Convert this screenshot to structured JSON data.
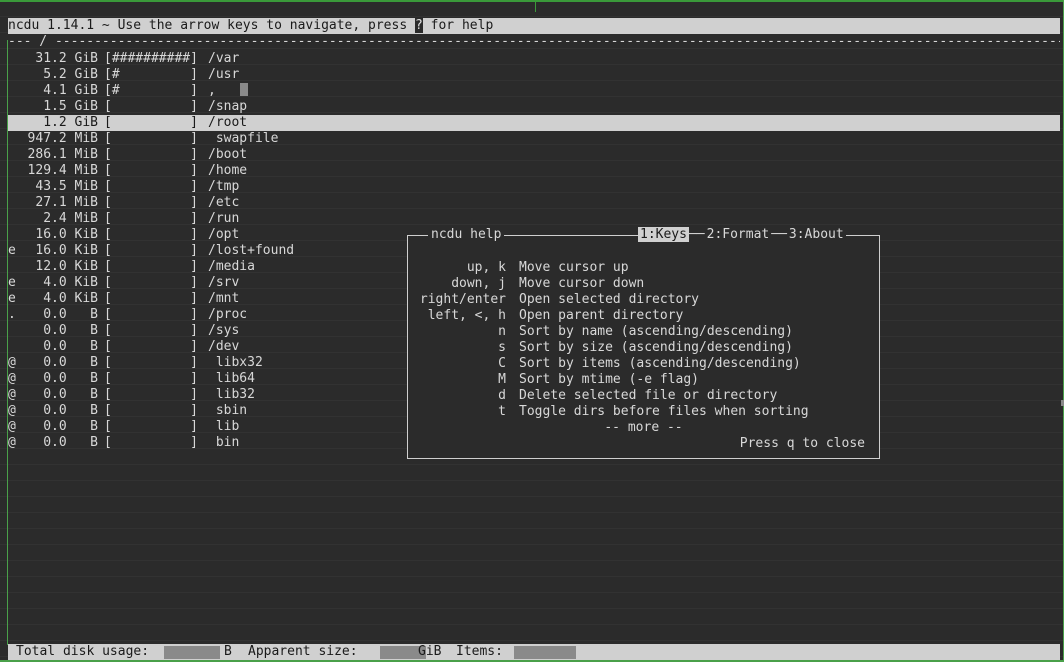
{
  "header": {
    "app": "ncdu 1.14.1",
    "tilde": "~",
    "text_before": " Use the arrow keys to navigate, press ",
    "help_key": "?",
    "text_after": " for help"
  },
  "path_line": "--- / ------------------------------------------------------------------------------------------------------------------------------------",
  "rows": [
    {
      "flag": "",
      "size": "31.2 GiB",
      "bar": "[##########]",
      "name": "/var"
    },
    {
      "flag": "",
      "size": "5.2 GiB",
      "bar": "[#         ]",
      "name": "/usr"
    },
    {
      "flag": "",
      "size": "4.1 GiB",
      "bar": "[#         ]",
      "name": ","
    },
    {
      "flag": "",
      "size": "1.5 GiB",
      "bar": "[          ]",
      "name": "/snap"
    },
    {
      "flag": "",
      "size": "1.2 GiB",
      "bar": "[          ]",
      "name": "/root",
      "selected": true
    },
    {
      "flag": "",
      "size": "947.2 MiB",
      "bar": "[          ]",
      "name": " swapfile"
    },
    {
      "flag": "",
      "size": "286.1 MiB",
      "bar": "[          ]",
      "name": "/boot"
    },
    {
      "flag": "",
      "size": "129.4 MiB",
      "bar": "[          ]",
      "name": "/home"
    },
    {
      "flag": "",
      "size": "43.5 MiB",
      "bar": "[          ]",
      "name": "/tmp"
    },
    {
      "flag": "",
      "size": "27.1 MiB",
      "bar": "[          ]",
      "name": "/etc"
    },
    {
      "flag": "",
      "size": "2.4 MiB",
      "bar": "[          ]",
      "name": "/run"
    },
    {
      "flag": "",
      "size": "16.0 KiB",
      "bar": "[          ]",
      "name": "/opt"
    },
    {
      "flag": "e",
      "size": "16.0 KiB",
      "bar": "[          ]",
      "name": "/lost+found"
    },
    {
      "flag": "",
      "size": "12.0 KiB",
      "bar": "[          ]",
      "name": "/media"
    },
    {
      "flag": "e",
      "size": "4.0 KiB",
      "bar": "[          ]",
      "name": "/srv"
    },
    {
      "flag": "e",
      "size": "4.0 KiB",
      "bar": "[          ]",
      "name": "/mnt"
    },
    {
      "flag": ".",
      "size": "0.0   B",
      "bar": "[          ]",
      "name": "/proc"
    },
    {
      "flag": "",
      "size": "0.0   B",
      "bar": "[          ]",
      "name": "/sys"
    },
    {
      "flag": "",
      "size": "0.0   B",
      "bar": "[          ]",
      "name": "/dev"
    },
    {
      "flag": "@",
      "size": "0.0   B",
      "bar": "[          ]",
      "name": " libx32"
    },
    {
      "flag": "@",
      "size": "0.0   B",
      "bar": "[          ]",
      "name": " lib64"
    },
    {
      "flag": "@",
      "size": "0.0   B",
      "bar": "[          ]",
      "name": " lib32"
    },
    {
      "flag": "@",
      "size": "0.0   B",
      "bar": "[          ]",
      "name": " sbin"
    },
    {
      "flag": "@",
      "size": "0.0   B",
      "bar": "[          ]",
      "name": " lib"
    },
    {
      "flag": "@",
      "size": "0.0   B",
      "bar": "[          ]",
      "name": " bin"
    }
  ],
  "help": {
    "title": "ncdu help",
    "tabs": [
      "1:Keys",
      "2:Format",
      "3:About"
    ],
    "active_tab": 0,
    "keys": [
      {
        "key": "up, k",
        "desc": "Move cursor up"
      },
      {
        "key": "down, j",
        "desc": "Move cursor down"
      },
      {
        "key": "right/enter",
        "desc": "Open selected directory"
      },
      {
        "key": "left, <, h",
        "desc": "Open parent directory"
      },
      {
        "key": "n",
        "desc": "Sort by name (ascending/descending)"
      },
      {
        "key": "s",
        "desc": "Sort by size (ascending/descending)"
      },
      {
        "key": "C",
        "desc": "Sort by items (ascending/descending)"
      },
      {
        "key": "M",
        "desc": "Sort by mtime (-e flag)"
      },
      {
        "key": "d",
        "desc": "Delete selected file or directory"
      },
      {
        "key": "t",
        "desc": "Toggle dirs before files when sorting"
      }
    ],
    "more": "-- more --",
    "close": "Press q to close"
  },
  "footer": {
    "total_label": "Total disk usage:",
    "total_suffix": "B",
    "apparent_label": "Apparent size:",
    "apparent_suffix": "GiB",
    "items_label": "Items:"
  },
  "colors": {
    "background": "#2b2b2b",
    "highlight_bar": "#d0d0d0",
    "text": "#d8d8d8",
    "frame_green": "#4aa04a"
  }
}
